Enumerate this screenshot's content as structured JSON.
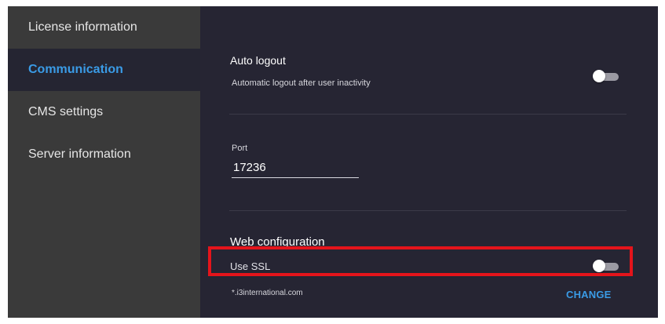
{
  "sidebar": {
    "items": [
      {
        "label": "License information"
      },
      {
        "label": "Communication"
      },
      {
        "label": "CMS settings"
      },
      {
        "label": "Server information"
      }
    ],
    "active_index": 1
  },
  "auto_logout": {
    "title": "Auto logout",
    "description": "Automatic logout after user inactivity",
    "enabled": false
  },
  "port": {
    "label": "Port",
    "value": "17236"
  },
  "web_configuration": {
    "title": "Web configuration",
    "use_ssl_label": "Use SSL",
    "use_ssl_enabled": false,
    "domain": "*.i3international.com",
    "change_label": "CHANGE"
  },
  "colors": {
    "accent": "#3a9be6",
    "sidebar_bg": "#3a3a3a",
    "content_bg": "#262533",
    "highlight": "#e4141b"
  }
}
